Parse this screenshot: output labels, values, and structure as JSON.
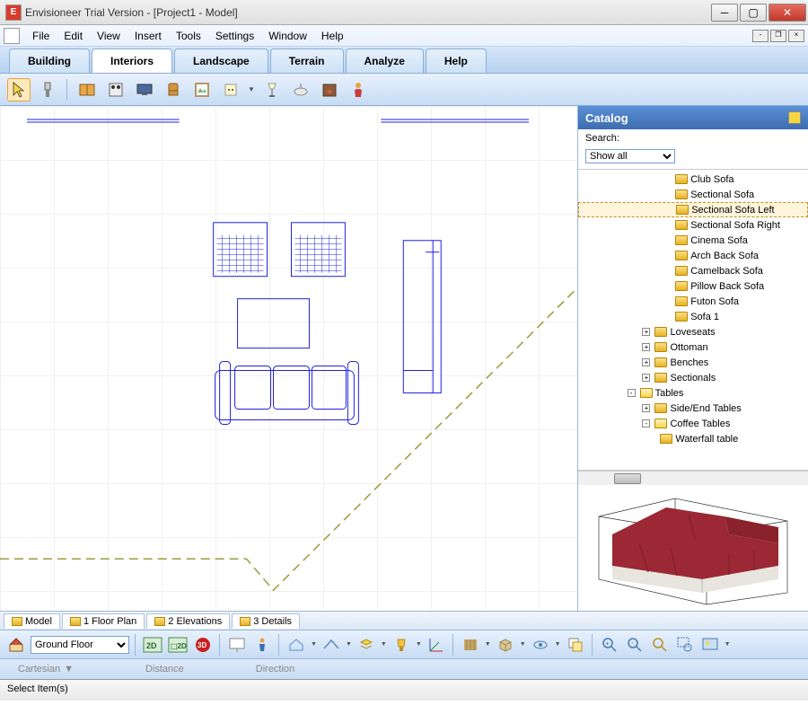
{
  "title": "Envisioneer Trial Version - [Project1 - Model]",
  "menubar": [
    "File",
    "Edit",
    "View",
    "Insert",
    "Tools",
    "Settings",
    "Window",
    "Help"
  ],
  "tabs": [
    "Building",
    "Interiors",
    "Landscape",
    "Terrain",
    "Analyze",
    "Help"
  ],
  "active_tab": 1,
  "catalog": {
    "title": "Catalog",
    "search_label": "Search:",
    "filter": "Show all",
    "tree": [
      {
        "depth": 6,
        "type": "item",
        "label": "Club Sofa"
      },
      {
        "depth": 6,
        "type": "item",
        "label": "Sectional Sofa"
      },
      {
        "depth": 6,
        "type": "item",
        "label": "Sectional Sofa Left",
        "selected": true
      },
      {
        "depth": 6,
        "type": "item",
        "label": "Sectional Sofa Right"
      },
      {
        "depth": 6,
        "type": "item",
        "label": "Cinema Sofa"
      },
      {
        "depth": 6,
        "type": "item",
        "label": "Arch Back Sofa"
      },
      {
        "depth": 6,
        "type": "item",
        "label": "Camelback Sofa"
      },
      {
        "depth": 6,
        "type": "item",
        "label": "Pillow Back Sofa"
      },
      {
        "depth": 6,
        "type": "item",
        "label": "Futon Sofa"
      },
      {
        "depth": 6,
        "type": "item",
        "label": "Sofa 1"
      },
      {
        "depth": 4,
        "type": "folder",
        "exp": "+",
        "label": "Loveseats"
      },
      {
        "depth": 4,
        "type": "folder",
        "exp": "+",
        "label": "Ottoman"
      },
      {
        "depth": 4,
        "type": "folder",
        "exp": "+",
        "label": "Benches"
      },
      {
        "depth": 4,
        "type": "folder",
        "exp": "+",
        "label": "Sectionals"
      },
      {
        "depth": 3,
        "type": "folder",
        "exp": "-",
        "open": true,
        "label": "Tables"
      },
      {
        "depth": 4,
        "type": "folder",
        "exp": "+",
        "label": "Side/End Tables"
      },
      {
        "depth": 4,
        "type": "folder",
        "exp": "-",
        "open": true,
        "label": "Coffee Tables"
      },
      {
        "depth": 5,
        "type": "item",
        "label": "Waterfall table"
      }
    ]
  },
  "viewtabs": [
    "Model",
    "1 Floor Plan",
    "2 Elevations",
    "3 Details"
  ],
  "floor": "Ground Floor",
  "coordbar": {
    "system": "Cartesian",
    "distance_label": "Distance",
    "direction_label": "Direction"
  },
  "status": "Select Item(s)"
}
